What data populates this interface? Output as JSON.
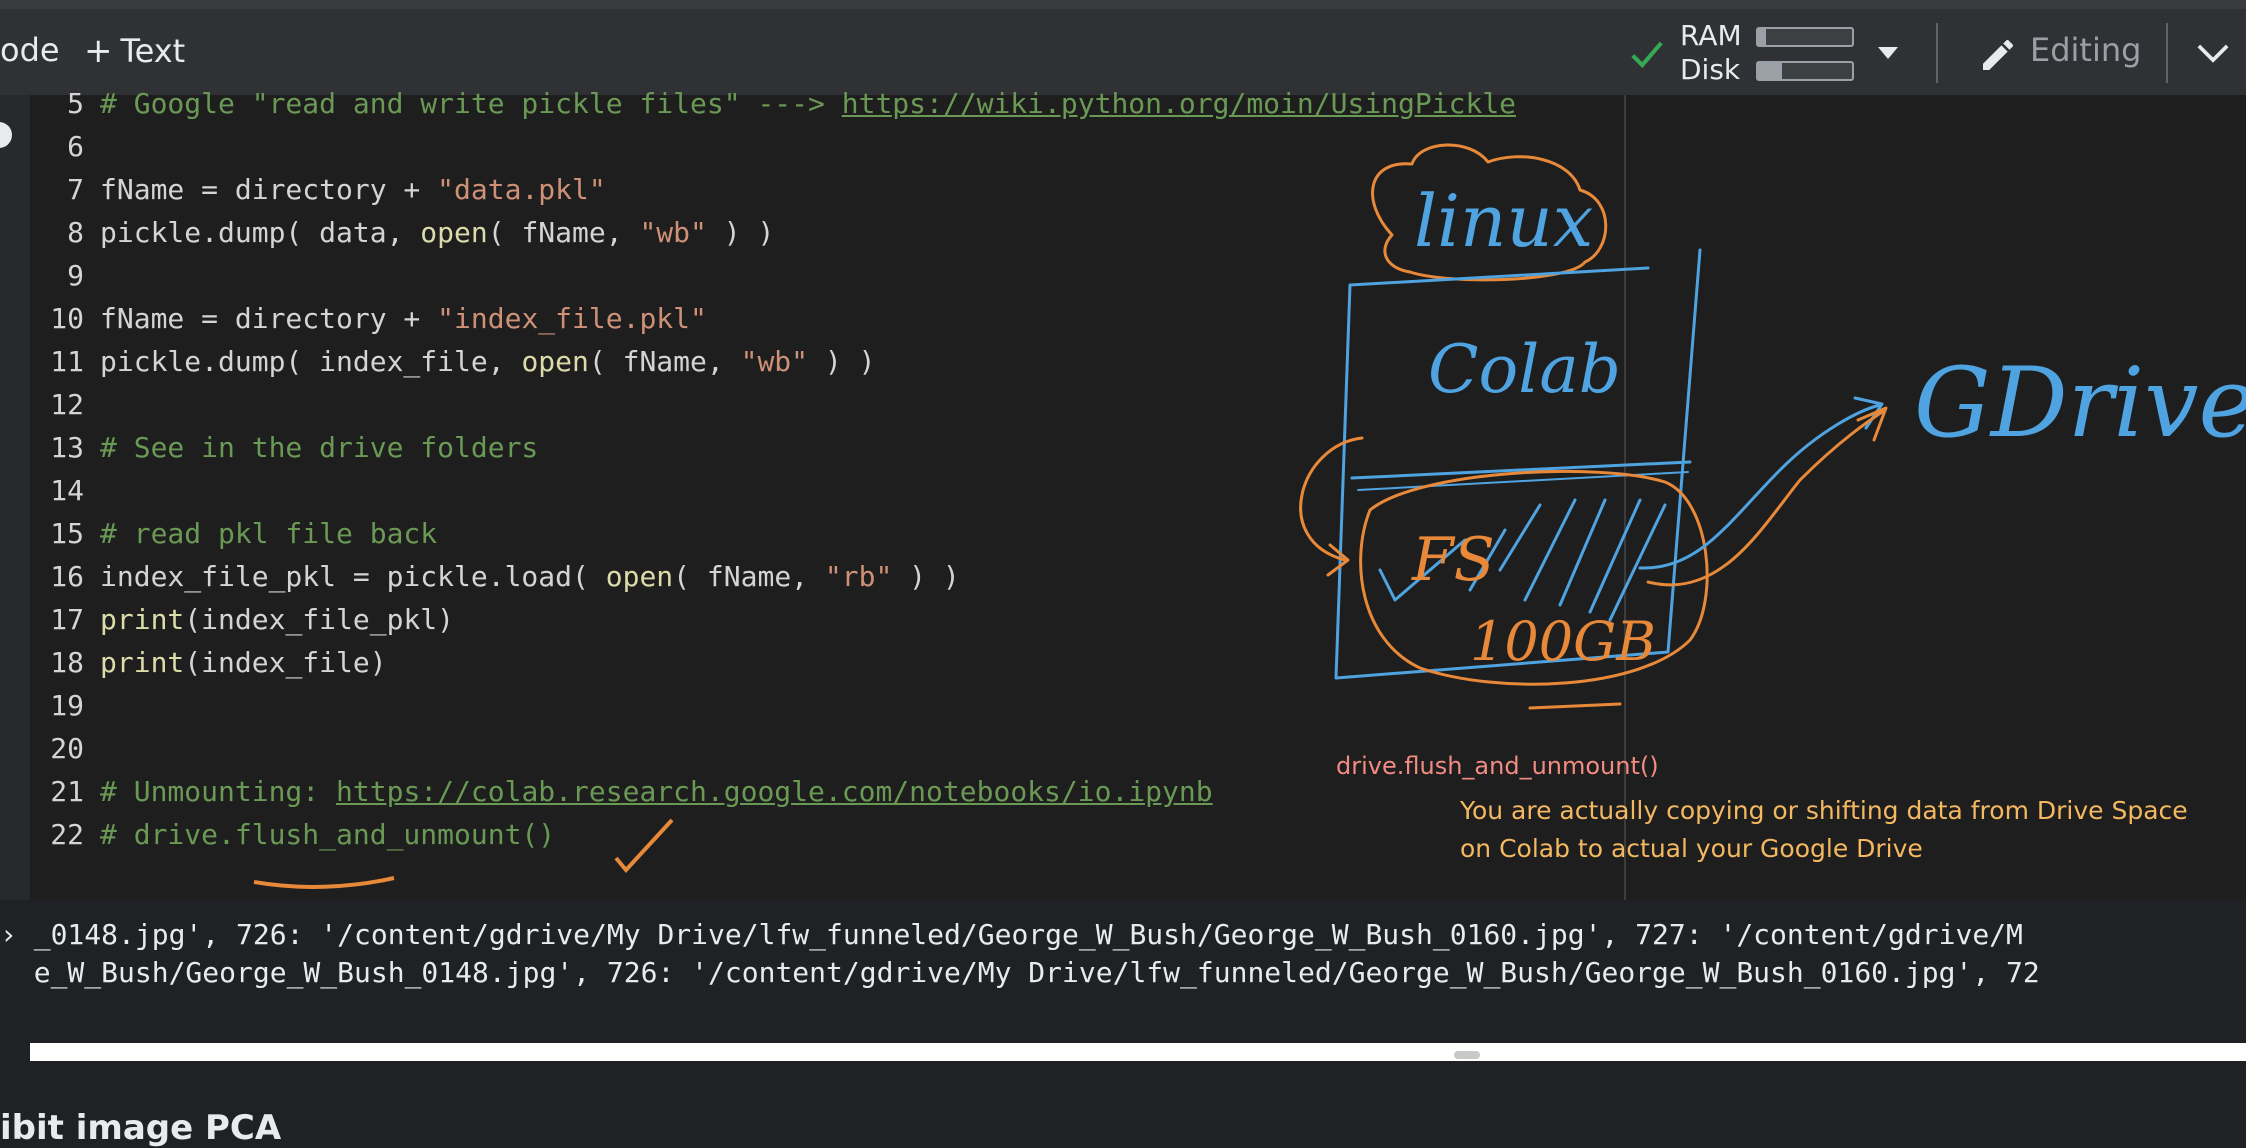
{
  "toolbar": {
    "code_label": "ode",
    "text_label": "Text",
    "ram_label": "RAM",
    "disk_label": "Disk",
    "ram_usage": 0.08,
    "disk_usage": 0.25,
    "editing_label": "Editing"
  },
  "code_lines": [
    {
      "n": "5",
      "seg1": "# Google \"read and write pickle files\" ---> ",
      "seg2": "https://wiki.python.org/moin/UsingPickle"
    },
    {
      "n": "6"
    },
    {
      "n": "7",
      "seg1": "fName = directory + ",
      "seg2": "\"data.pkl\""
    },
    {
      "n": "8",
      "seg1": "pickle.dump( data, ",
      "seg2": "open",
      "seg3": "( fName, ",
      "seg4": "\"wb\"",
      "seg5": " ) )"
    },
    {
      "n": "9"
    },
    {
      "n": "10",
      "seg1": "fName = directory + ",
      "seg2": "\"index_file.pkl\""
    },
    {
      "n": "11",
      "seg1": "pickle.dump( index_file, ",
      "seg2": "open",
      "seg3": "( fName, ",
      "seg4": "\"wb\"",
      "seg5": " ) )"
    },
    {
      "n": "12"
    },
    {
      "n": "13",
      "seg1": "# See in the drive folders"
    },
    {
      "n": "14"
    },
    {
      "n": "15",
      "seg1": "# read pkl file back"
    },
    {
      "n": "16",
      "seg1": "index_file_pkl = pickle.load( ",
      "seg2": "open",
      "seg3": "( fName, ",
      "seg4": "\"rb\"",
      "seg5": " ) )"
    },
    {
      "n": "17",
      "seg1": "print",
      "seg2": "(index_file_pkl)"
    },
    {
      "n": "18",
      "seg1": "print",
      "seg2": "(index_file)"
    },
    {
      "n": "19"
    },
    {
      "n": "20"
    },
    {
      "n": "21",
      "seg1": "# Unmounting: ",
      "seg2": "https://colab.research.google.com/notebooks/io.ipynb"
    },
    {
      "n": "22",
      "seg1": "# drive.flush_and_unmount()"
    }
  ],
  "sketch": {
    "linux": "linux",
    "colab": "Colab",
    "fs": "FS",
    "size": "100GB",
    "gdrive": "GDrive"
  },
  "annotations": {
    "red": "drive.flush_and_unmount()",
    "yellow_line1": "You are actually copying or shifting data from Drive Space",
    "yellow_line2": "on Colab to actual your Google Drive"
  },
  "output": {
    "line1": "› _0148.jpg', 726: '/content/gdrive/My Drive/lfw_funneled/George_W_Bush/George_W_Bush_0160.jpg', 727: '/content/gdrive/M",
    "line2": "  e_W_Bush/George_W_Bush_0148.jpg', 726: '/content/gdrive/My Drive/lfw_funneled/George_W_Bush/George_W_Bush_0160.jpg', 72"
  },
  "footer": {
    "partial_heading": "ibit image PCA"
  },
  "colors": {
    "comment": "#6a9955",
    "string": "#ce9178",
    "function": "#dcdcaa",
    "sketch_blue": "#4fa3e0",
    "sketch_orange": "#e8893a"
  }
}
